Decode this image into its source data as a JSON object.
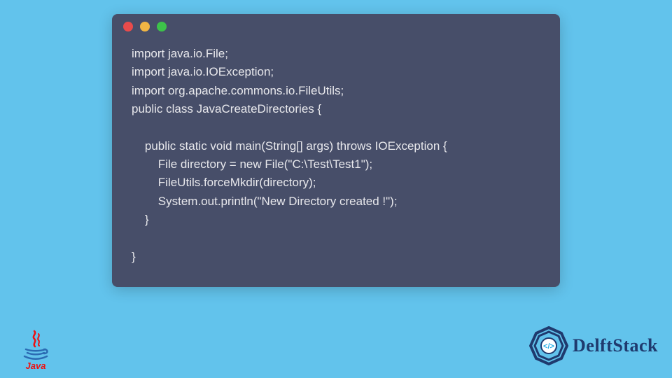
{
  "window": {
    "dots": {
      "red": "#e94b4b",
      "yellow": "#f0b544",
      "green": "#3dc24a"
    }
  },
  "code": {
    "lines": [
      "import java.io.File;",
      "import java.io.IOException;",
      "import org.apache.commons.io.FileUtils;",
      "public class JavaCreateDirectories {",
      "",
      "    public static void main(String[] args) throws IOException {",
      "        File directory = new File(\"C:\\Test\\Test1\");",
      "        FileUtils.forceMkdir(directory);",
      "        System.out.println(\"New Directory created !\");",
      "    }",
      "",
      "}"
    ]
  },
  "logos": {
    "java_label": "Java",
    "delft_label": "DelftStack"
  }
}
